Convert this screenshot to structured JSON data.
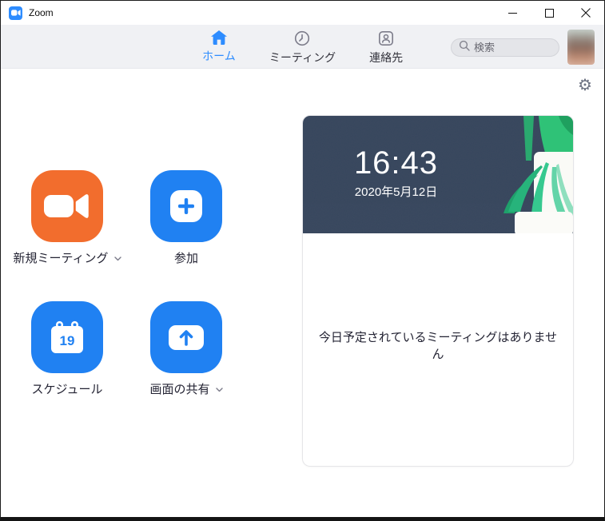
{
  "window": {
    "title": "Zoom",
    "controls": [
      {
        "id": "minimize",
        "icon": "minimize-icon"
      },
      {
        "id": "maximize",
        "icon": "maximize-icon"
      },
      {
        "id": "close",
        "icon": "close-icon"
      }
    ]
  },
  "navbar": {
    "tabs": [
      {
        "id": "home",
        "label": "ホーム",
        "icon": "home-icon",
        "active": true
      },
      {
        "id": "meetings",
        "label": "ミーティング",
        "icon": "clock-icon",
        "active": false
      },
      {
        "id": "contacts",
        "label": "連絡先",
        "icon": "contacts-icon",
        "active": false
      }
    ],
    "search": {
      "placeholder": "検索"
    }
  },
  "icons": {
    "gear": "⚙"
  },
  "actions": [
    {
      "id": "new-meeting",
      "label": "新規ミーティング",
      "has_dropdown": true
    },
    {
      "id": "join",
      "label": "参加",
      "has_dropdown": false
    },
    {
      "id": "schedule",
      "label": "スケジュール",
      "calendar_day": "19",
      "has_dropdown": false
    },
    {
      "id": "share-screen",
      "label": "画面の共有",
      "has_dropdown": true
    }
  ],
  "meetings_panel": {
    "time": "16:43",
    "date": "2020年5月12日",
    "empty_message": "今日予定されているミーティングはありません"
  },
  "colors": {
    "accent_orange": "#f26d2d",
    "accent_blue": "#2081f2",
    "active_tab_blue": "#2d8cff",
    "panel_header_navy": "#37465d"
  }
}
